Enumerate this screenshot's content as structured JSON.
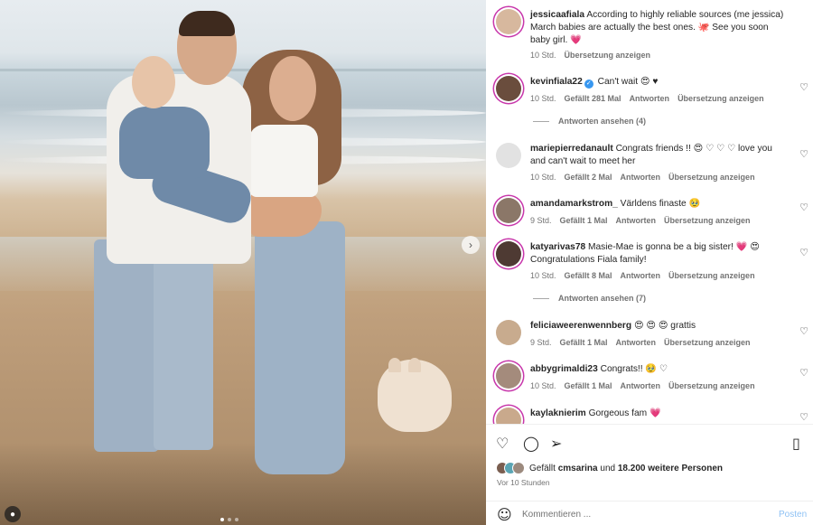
{
  "post": {
    "author": "jessicaafiala",
    "caption": "According to highly reliable sources (me jessica) March babies are actually the best ones. 🐙 See you soon baby girl. 💗",
    "time": "10 Std.",
    "translate": "Übersetzung anzeigen"
  },
  "comments": [
    {
      "user": "kevinfiala22",
      "verified": true,
      "text": "Can't wait 😍 ♥",
      "time": "10 Std.",
      "likes": "Gefällt 281 Mal",
      "reply": "Antworten",
      "translate": "Übersetzung anzeigen",
      "view_replies": "Antworten ansehen (4)"
    },
    {
      "user": "mariepierredanault",
      "text": "Congrats friends !! 😍 ♡ ♡ ♡ love you and can't wait to meet her",
      "time": "10 Std.",
      "likes": "Gefällt 2 Mal",
      "reply": "Antworten",
      "translate": "Übersetzung anzeigen"
    },
    {
      "user": "amandamarkstrom_",
      "text": "Världens finaste 🥹",
      "time": "9 Std.",
      "likes": "Gefällt 1 Mal",
      "reply": "Antworten",
      "translate": "Übersetzung anzeigen"
    },
    {
      "user": "katyarivas78",
      "text": "Masie-Mae is gonna be a big sister! 💗 😍 Congratulations Fiala family!",
      "time": "10 Std.",
      "likes": "Gefällt 8 Mal",
      "reply": "Antworten",
      "translate": "Übersetzung anzeigen",
      "view_replies": "Antworten ansehen (7)"
    },
    {
      "user": "feliciaweerenwennberg",
      "text": "😍 😍 😍 grattis",
      "time": "9 Std.",
      "likes": "Gefällt 1 Mal",
      "reply": "Antworten",
      "translate": "Übersetzung anzeigen"
    },
    {
      "user": "abbygrimaldi23",
      "text": "Congrats!! 🥹 ♡",
      "time": "10 Std.",
      "likes": "Gefällt 1 Mal",
      "reply": "Antworten",
      "translate": "Übersetzung anzeigen"
    },
    {
      "user": "kaylaknierim",
      "text": "Gorgeous fam 💗"
    }
  ],
  "likes": {
    "prefix": "Gefällt",
    "user": "cmsarina",
    "middle": "und",
    "count": "18.200 weitere Personen"
  },
  "date": "Vor 10 Stunden",
  "add_comment": {
    "placeholder": "Kommentieren ...",
    "post_label": "Posten"
  },
  "icons": {
    "like": "heart-icon",
    "comment": "comment-icon",
    "share": "share-icon",
    "save": "bookmark-icon",
    "emoji": "smiley-icon",
    "next": "chevron-right-icon",
    "tag": "user-tag-icon"
  },
  "colors": {
    "link_blue": "#3897f0",
    "post_disabled": "#8fc2f4",
    "story_ring": "#c837ab"
  }
}
